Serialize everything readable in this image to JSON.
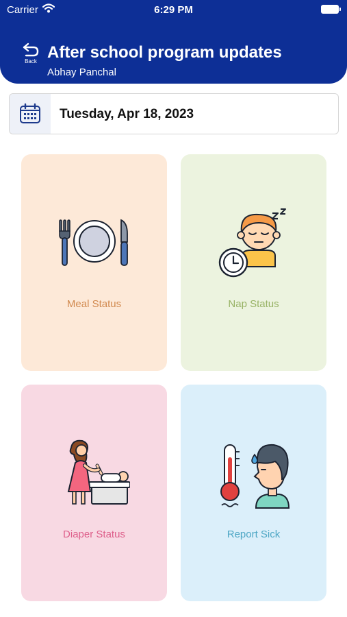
{
  "status_bar": {
    "carrier": "Carrier",
    "time": "6:29 PM"
  },
  "header": {
    "back_label": "Back",
    "title": "After school program updates",
    "subtitle": "Abhay Panchal"
  },
  "date_bar": {
    "icon": "calendar-icon",
    "date": "Tuesday, Apr 18, 2023"
  },
  "cards": [
    {
      "label": "Meal Status",
      "icon": "meal-plate-icon",
      "bg": "#fde9d8",
      "color": "#d1894e"
    },
    {
      "label": "Nap Status",
      "icon": "sleeping-child-icon",
      "bg": "#ecf3df",
      "color": "#97b264"
    },
    {
      "label": "Diaper Status",
      "icon": "diaper-change-icon",
      "bg": "#f8d9e3",
      "color": "#de5f8b"
    },
    {
      "label": "Report Sick",
      "icon": "thermometer-sick-icon",
      "bg": "#dbeffa",
      "color": "#4ea7c5"
    }
  ],
  "colors": {
    "header": "#0d2f96",
    "white": "#ffffff"
  }
}
